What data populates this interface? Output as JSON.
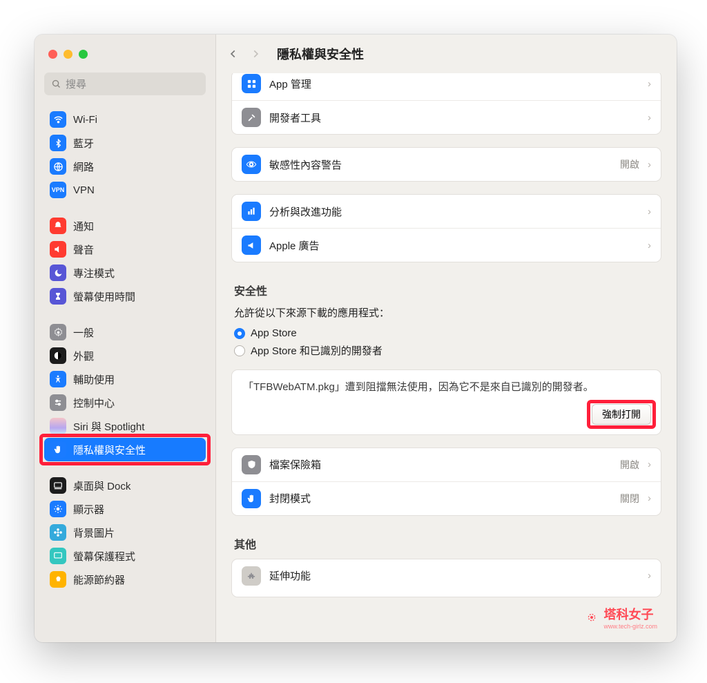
{
  "search_placeholder": "搜尋",
  "title": "隱私權與安全性",
  "sidebar": [
    {
      "label": "Wi-Fi"
    },
    {
      "label": "藍牙"
    },
    {
      "label": "網路"
    },
    {
      "label": "VPN"
    }
  ],
  "sidebar2": [
    {
      "label": "通知"
    },
    {
      "label": "聲音"
    },
    {
      "label": "專注模式"
    },
    {
      "label": "螢幕使用時間"
    }
  ],
  "sidebar3": [
    {
      "label": "一般"
    },
    {
      "label": "外觀"
    },
    {
      "label": "輔助使用"
    },
    {
      "label": "控制中心"
    },
    {
      "label": "Siri 與 Spotlight"
    },
    {
      "label": "隱私權與安全性"
    }
  ],
  "sidebar4": [
    {
      "label": "桌面與 Dock"
    },
    {
      "label": "顯示器"
    },
    {
      "label": "背景圖片"
    },
    {
      "label": "螢幕保護程式"
    },
    {
      "label": "能源節約器"
    }
  ],
  "rows_top": [
    {
      "label": "App 管理"
    },
    {
      "label": "開發者工具"
    }
  ],
  "row_sensitive": {
    "label": "敏感性內容警告",
    "status": "開啟"
  },
  "rows_analytics": [
    {
      "label": "分析與改進功能"
    },
    {
      "label": "Apple 廣告"
    }
  ],
  "sec_title": "安全性",
  "allow_line": "允許從以下來源下載的應用程式：",
  "radio1": "App Store",
  "radio2": "App Store 和已識別的開發者",
  "blocked_msg": "「TFBWebATM.pkg」遭到阻擋無法使用，因為它不是來自已識別的開發者。",
  "force_open": "強制打開",
  "rows_sec2": [
    {
      "label": "檔案保險箱",
      "status": "開啟"
    },
    {
      "label": "封閉模式",
      "status": "關閉"
    }
  ],
  "other_title": "其他",
  "row_ext": {
    "label": "延伸功能"
  },
  "watermark": {
    "name": "塔科女子",
    "url": "www.tech-girlz.com"
  }
}
